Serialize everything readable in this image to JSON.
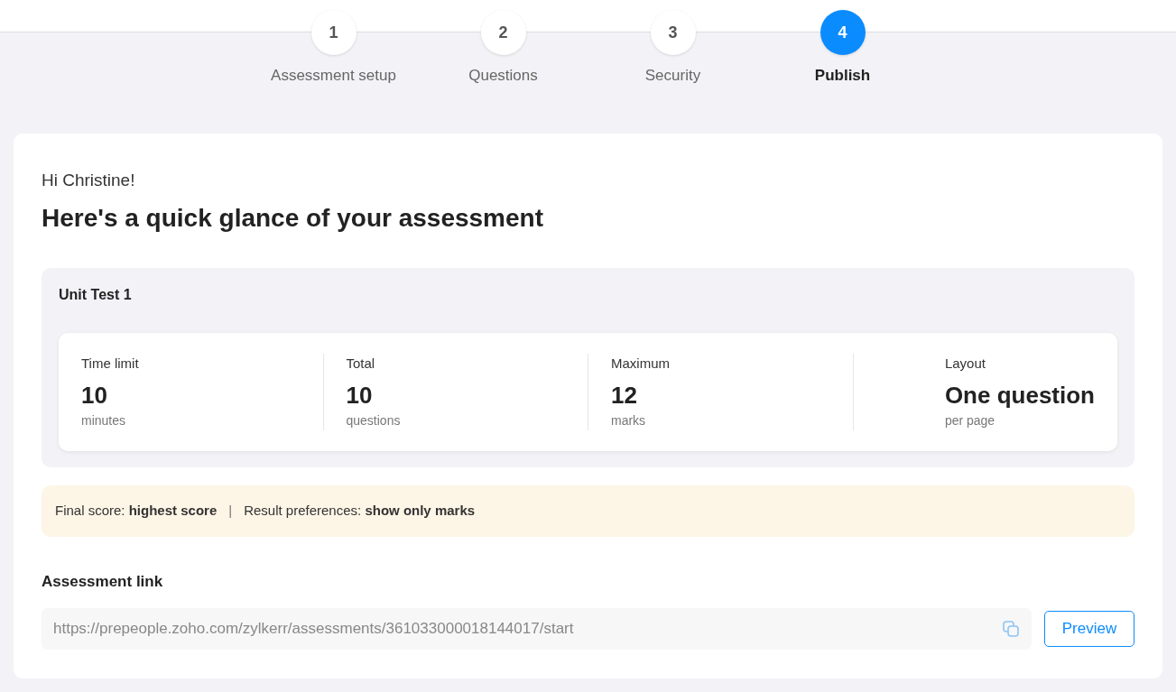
{
  "steps": [
    {
      "number": "1",
      "label": "Assessment setup",
      "selected": false
    },
    {
      "number": "2",
      "label": "Questions",
      "selected": false
    },
    {
      "number": "3",
      "label": "Security",
      "selected": false
    },
    {
      "number": "4",
      "label": "Publish",
      "selected": true
    }
  ],
  "greeting": "Hi Christine!",
  "heading": "Here's a quick glance of your assessment",
  "assessment": {
    "title": "Unit Test 1",
    "stats": [
      {
        "label": "Time limit",
        "value": "10",
        "unit": "minutes"
      },
      {
        "label": "Total",
        "value": "10",
        "unit": "questions"
      },
      {
        "label": "Maximum",
        "value": "12",
        "unit": "marks"
      },
      {
        "label": "Layout",
        "value": "One question",
        "unit": "per page"
      }
    ]
  },
  "summary": {
    "final_score": "Final score: **highest score**",
    "separator": "|",
    "result_preferences": "Result preferences: **show only marks**"
  },
  "link": {
    "label": "Assessment link",
    "value": "https://prepeople.zoho.com/zylkerr/assessments/361033000018144017/start",
    "button": "Preview"
  }
}
